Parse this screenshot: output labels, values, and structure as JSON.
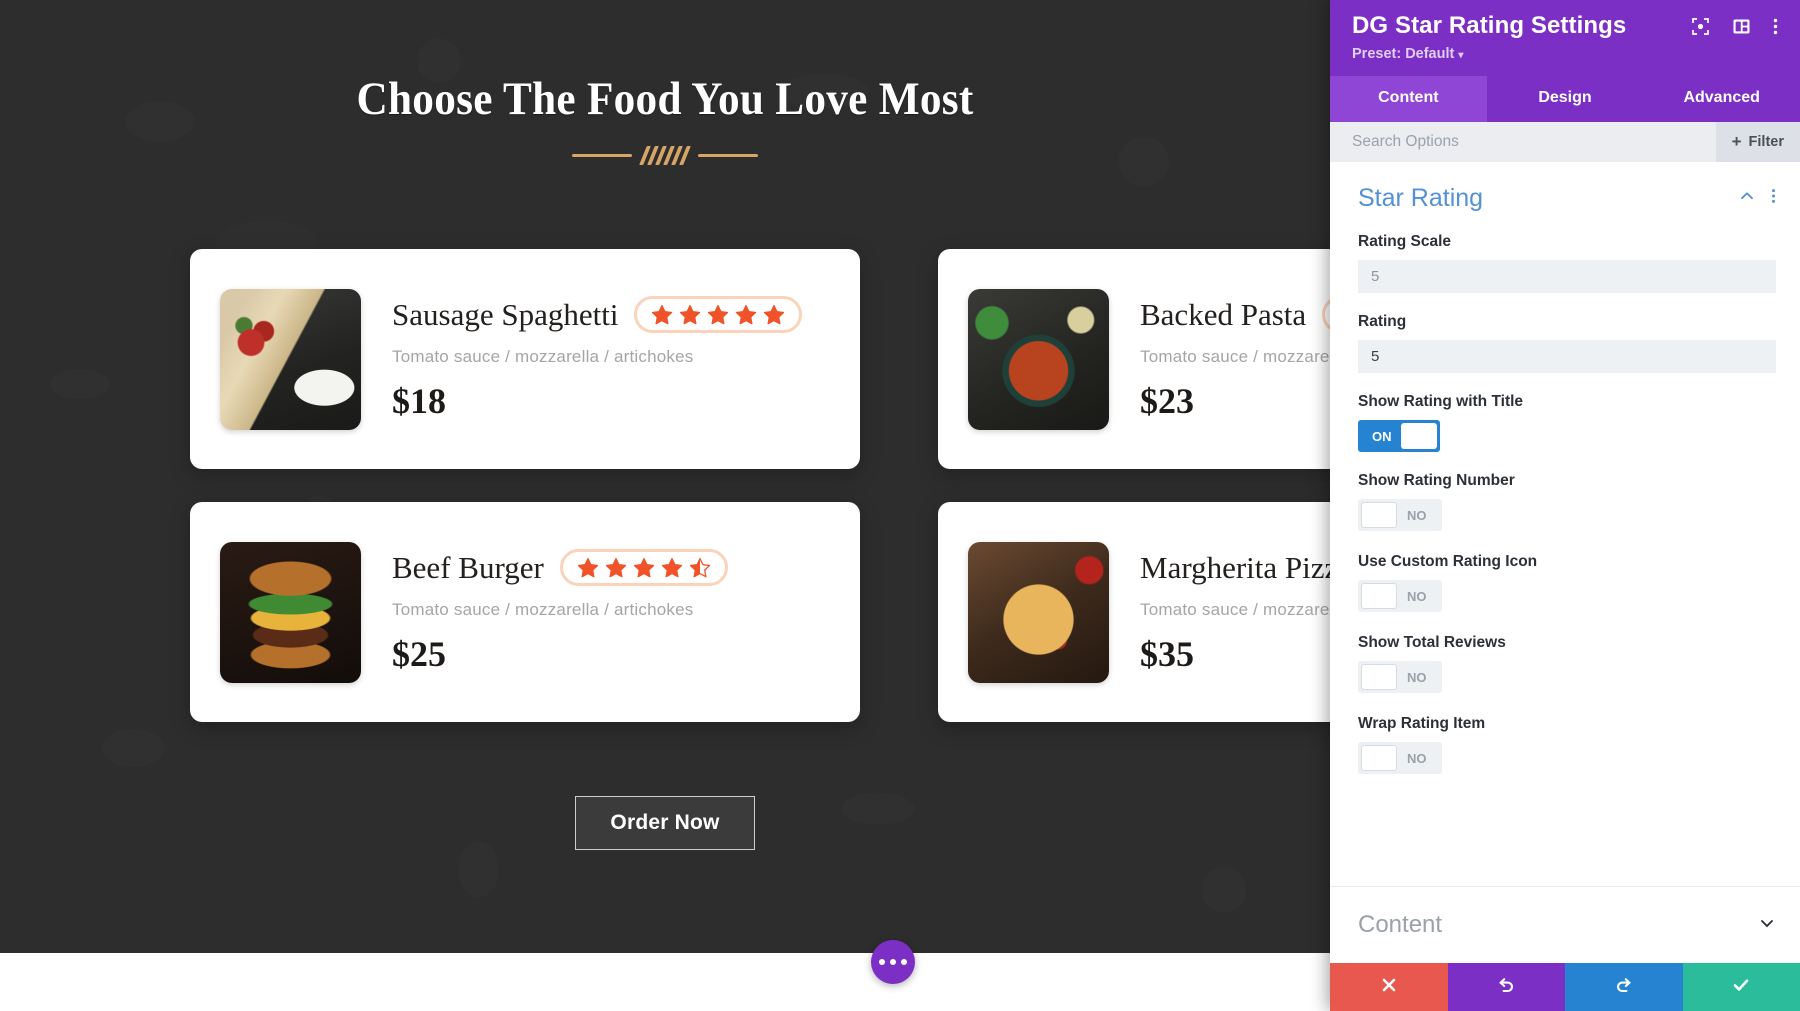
{
  "page": {
    "heading": "Choose The Food You Love Most",
    "order_button": "Order Now",
    "items": [
      {
        "title": "Sausage Spaghetti",
        "description": "Tomato sauce / mozzarella / artichokes",
        "price": "$18",
        "rating": 5,
        "rating_scale": 5,
        "thumb": "sausage-spaghetti-photo"
      },
      {
        "title": "Backed Pasta",
        "description": "Tomato sauce / mozzarella / artichokes",
        "price": "$23",
        "rating": 5,
        "rating_scale": 5,
        "thumb": "backed-pasta-photo"
      },
      {
        "title": "Beef Burger",
        "description": "Tomato sauce / mozzarella / artichokes",
        "price": "$25",
        "rating": 4.5,
        "rating_scale": 5,
        "thumb": "beef-burger-photo"
      },
      {
        "title": "Margherita Pizza",
        "description": "Tomato sauce / mozzarella / artichokes",
        "price": "$35",
        "rating": 5,
        "rating_scale": 5,
        "thumb": "margherita-pizza-photo"
      }
    ],
    "fab": "options-ellipsis-button"
  },
  "panel": {
    "title": "DG Star Rating Settings",
    "preset_label": "Preset: Default",
    "preset_caret": "▾",
    "header_icons": [
      "focus-target-icon",
      "layout-panel-icon",
      "overflow-menu-icon"
    ],
    "tabs": [
      {
        "label": "Content",
        "active": true
      },
      {
        "label": "Design",
        "active": false
      },
      {
        "label": "Advanced",
        "active": false
      }
    ],
    "search_placeholder": "Search Options",
    "filter_label": "Filter",
    "filter_plus": "+",
    "section": {
      "title": "Star Rating",
      "collapse_icon": "chevron-up-icon",
      "menu_icon": "overflow-menu-icon"
    },
    "fields": [
      {
        "label": "Rating Scale",
        "value": "5",
        "filled": false
      },
      {
        "label": "Rating",
        "value": "5",
        "filled": true
      }
    ],
    "toggles": [
      {
        "label": "Show Rating with Title",
        "state": "ON",
        "on": true
      },
      {
        "label": "Show Rating Number",
        "state": "NO",
        "on": false
      },
      {
        "label": "Use Custom Rating Icon",
        "state": "NO",
        "on": false
      },
      {
        "label": "Show Total Reviews",
        "state": "NO",
        "on": false
      },
      {
        "label": "Wrap Rating Item",
        "state": "NO",
        "on": false
      }
    ],
    "content_section": {
      "title": "Content",
      "expand_icon": "chevron-down-icon"
    },
    "actions": [
      {
        "name": "close",
        "icon": "✕"
      },
      {
        "name": "undo",
        "icon": "↺"
      },
      {
        "name": "redo",
        "icon": "↻"
      },
      {
        "name": "save",
        "icon": "✓"
      }
    ]
  },
  "colors": {
    "panel_purple": "#7b2fc4",
    "tab_active": "#8f45d6",
    "section_blue": "#5491d4",
    "toggle_on": "#2683d1",
    "star_orange": "#f0522a",
    "star_pill_border": "#fbd3ba",
    "divider_gold": "#d8a566",
    "canvas_dark": "#2d2d2d",
    "action_close": "#e8584f",
    "action_undo": "#7b2fc4",
    "action_redo": "#2683d1",
    "action_save": "#2bbc9b"
  }
}
